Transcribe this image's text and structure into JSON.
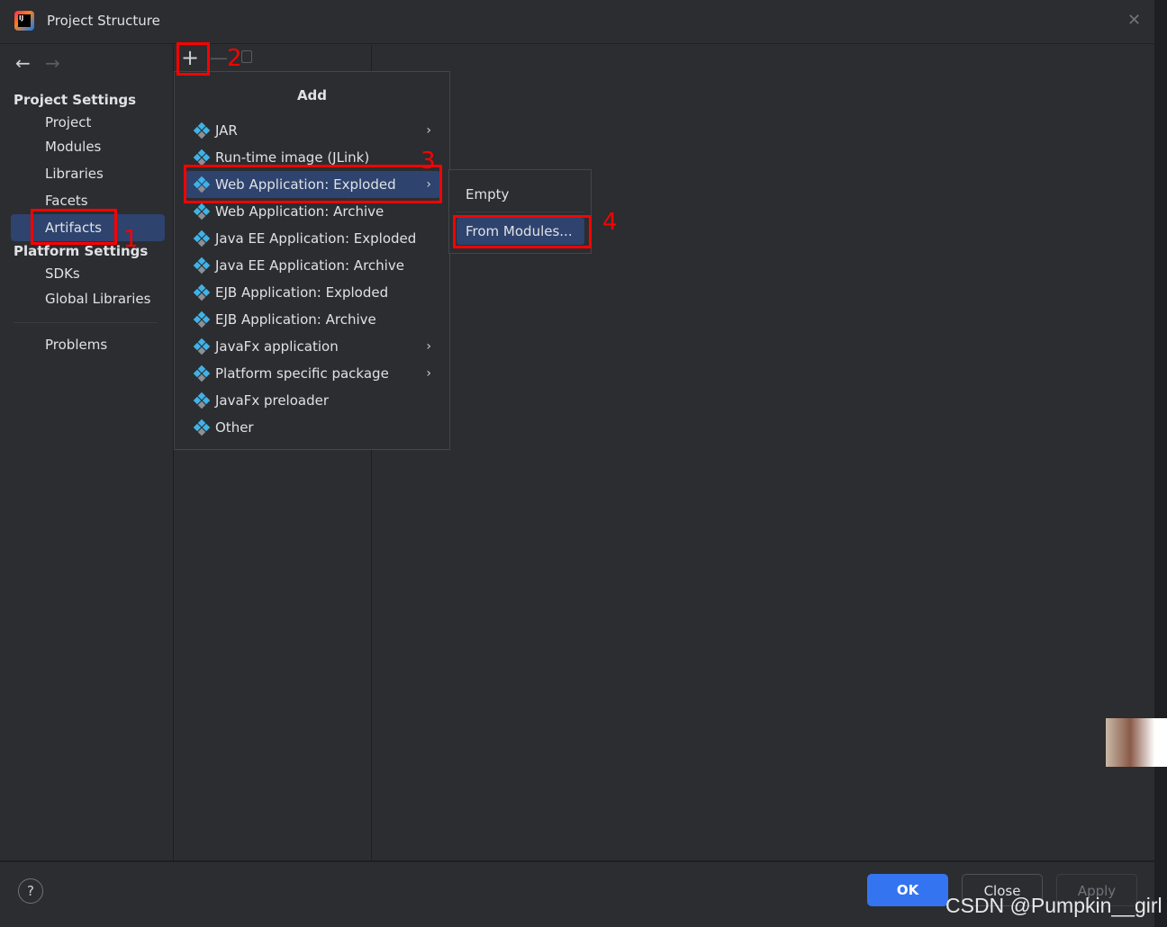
{
  "window": {
    "title": "Project Structure"
  },
  "sidebar": {
    "project_settings": "Project Settings",
    "items": [
      "Project",
      "Modules",
      "Libraries",
      "Facets",
      "Artifacts"
    ],
    "platform_settings": "Platform Settings",
    "platform_items": [
      "SDKs",
      "Global Libraries"
    ],
    "problems": "Problems"
  },
  "menu": {
    "title": "Add",
    "items": [
      {
        "label": "JAR",
        "submenu": true
      },
      {
        "label": "Run-time image (JLink)"
      },
      {
        "label": "Web Application: Exploded",
        "submenu": true
      },
      {
        "label": "Web Application: Archive"
      },
      {
        "label": "Java EE Application: Exploded"
      },
      {
        "label": "Java EE Application: Archive"
      },
      {
        "label": "EJB Application: Exploded"
      },
      {
        "label": "EJB Application: Archive"
      },
      {
        "label": "JavaFx application",
        "submenu": true
      },
      {
        "label": "Platform specific package",
        "submenu": true
      },
      {
        "label": "JavaFx preloader"
      },
      {
        "label": "Other"
      }
    ]
  },
  "submenu": {
    "items": [
      "Empty",
      "From Modules..."
    ]
  },
  "annotations": [
    "1",
    "2",
    "3",
    "4"
  ],
  "footer": {
    "help": "?",
    "ok": "OK",
    "close": "Close",
    "apply": "Apply"
  },
  "watermark": "CSDN @Pumpkin__girl",
  "colors": {
    "accent": "#3574f0",
    "selection": "#2e436e",
    "annotation": "#ff0000"
  }
}
